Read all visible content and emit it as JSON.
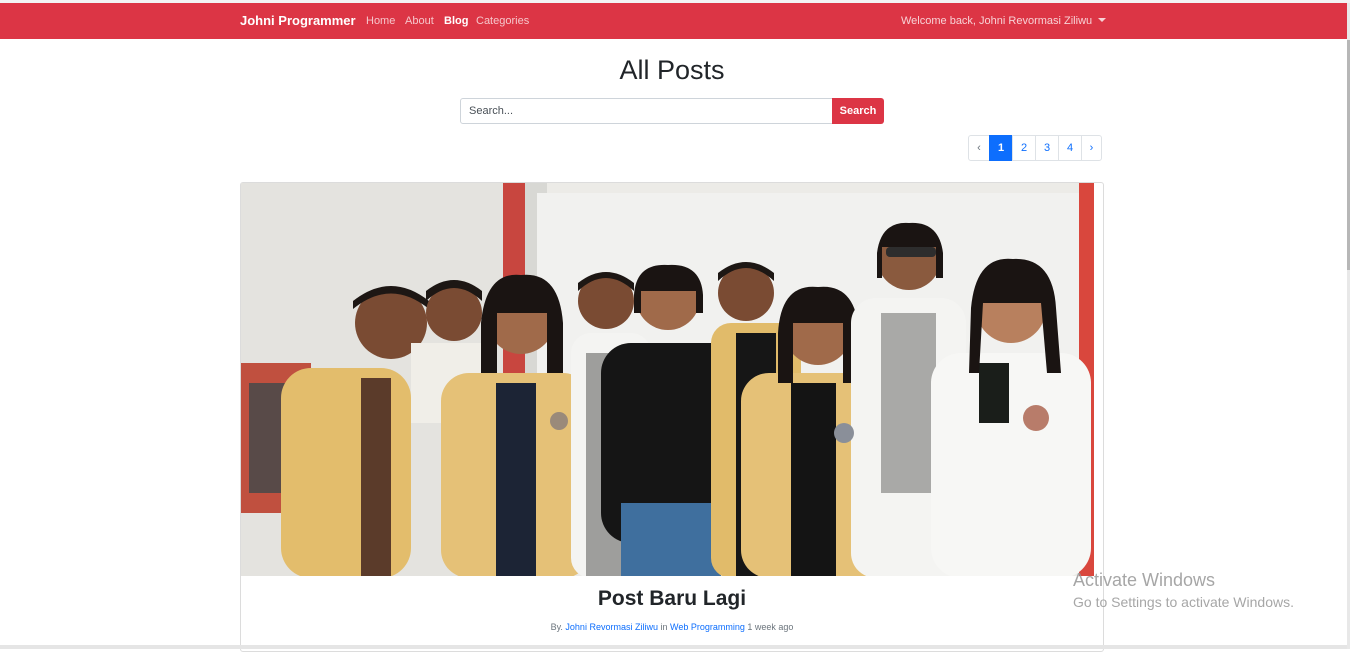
{
  "navbar": {
    "brand": "Johni Programmer",
    "links": [
      {
        "label": "Home",
        "active": false
      },
      {
        "label": "About",
        "active": false
      },
      {
        "label": "Blog",
        "active": true
      },
      {
        "label": "Categories",
        "active": false
      }
    ],
    "welcome": "Welcome back, Johni Revormasi Ziliwu",
    "color": "#dc3545"
  },
  "main": {
    "title": "All Posts",
    "search": {
      "placeholder": "Search...",
      "button": "Search"
    },
    "pagination": {
      "prev": "‹",
      "next": "›",
      "pages": [
        "1",
        "2",
        "3",
        "4"
      ],
      "active": "1"
    }
  },
  "post": {
    "title": "Post Baru Lagi",
    "by": "By.",
    "author": "Johni Revormasi Ziliwu",
    "in": "in",
    "category": "Web Programming",
    "time": "1 week ago"
  },
  "watermark": {
    "line1": "Activate Windows",
    "line2": "Go to Settings to activate Windows."
  }
}
